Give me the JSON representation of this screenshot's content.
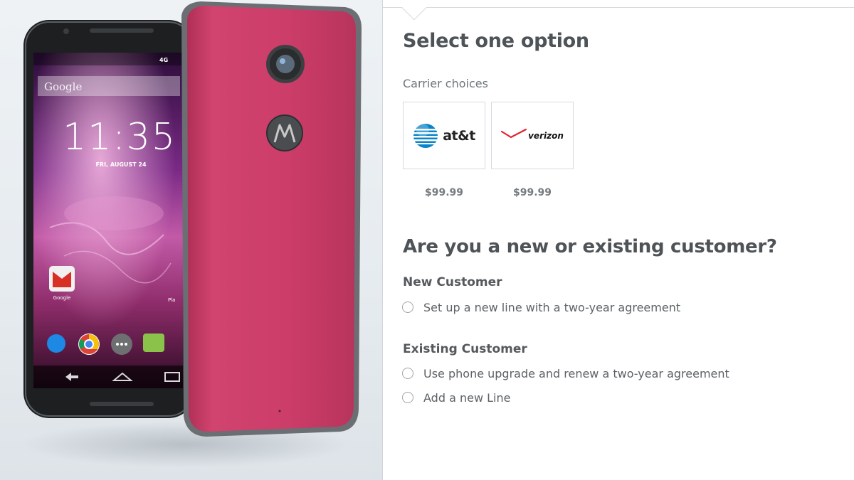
{
  "product_image": {
    "lock_screen": {
      "search_brand": "Google",
      "clock": "11:35",
      "date": "FRI, AUGUST 24",
      "status": "4G",
      "app_label_left": "Google",
      "app_label_right": "Pla"
    },
    "back_color": "#c83a66"
  },
  "options": {
    "title": "Select one option",
    "carrier_label": "Carrier choices",
    "carriers": [
      {
        "name": "at&t",
        "price": "$99.99"
      },
      {
        "name": "verizon",
        "price": "$99.99"
      }
    ]
  },
  "customer": {
    "title": "Are you a new or existing customer?",
    "new_group": {
      "label": "New Customer",
      "options": [
        "Set up a new line with a two-year agreement"
      ]
    },
    "existing_group": {
      "label": "Existing Customer",
      "options": [
        "Use phone upgrade and renew a two-year agreement",
        "Add a new Line"
      ]
    }
  },
  "colors": {
    "accent_red": "#e0242f",
    "att_blue": "#0a84c9",
    "heading": "#4e5357"
  }
}
